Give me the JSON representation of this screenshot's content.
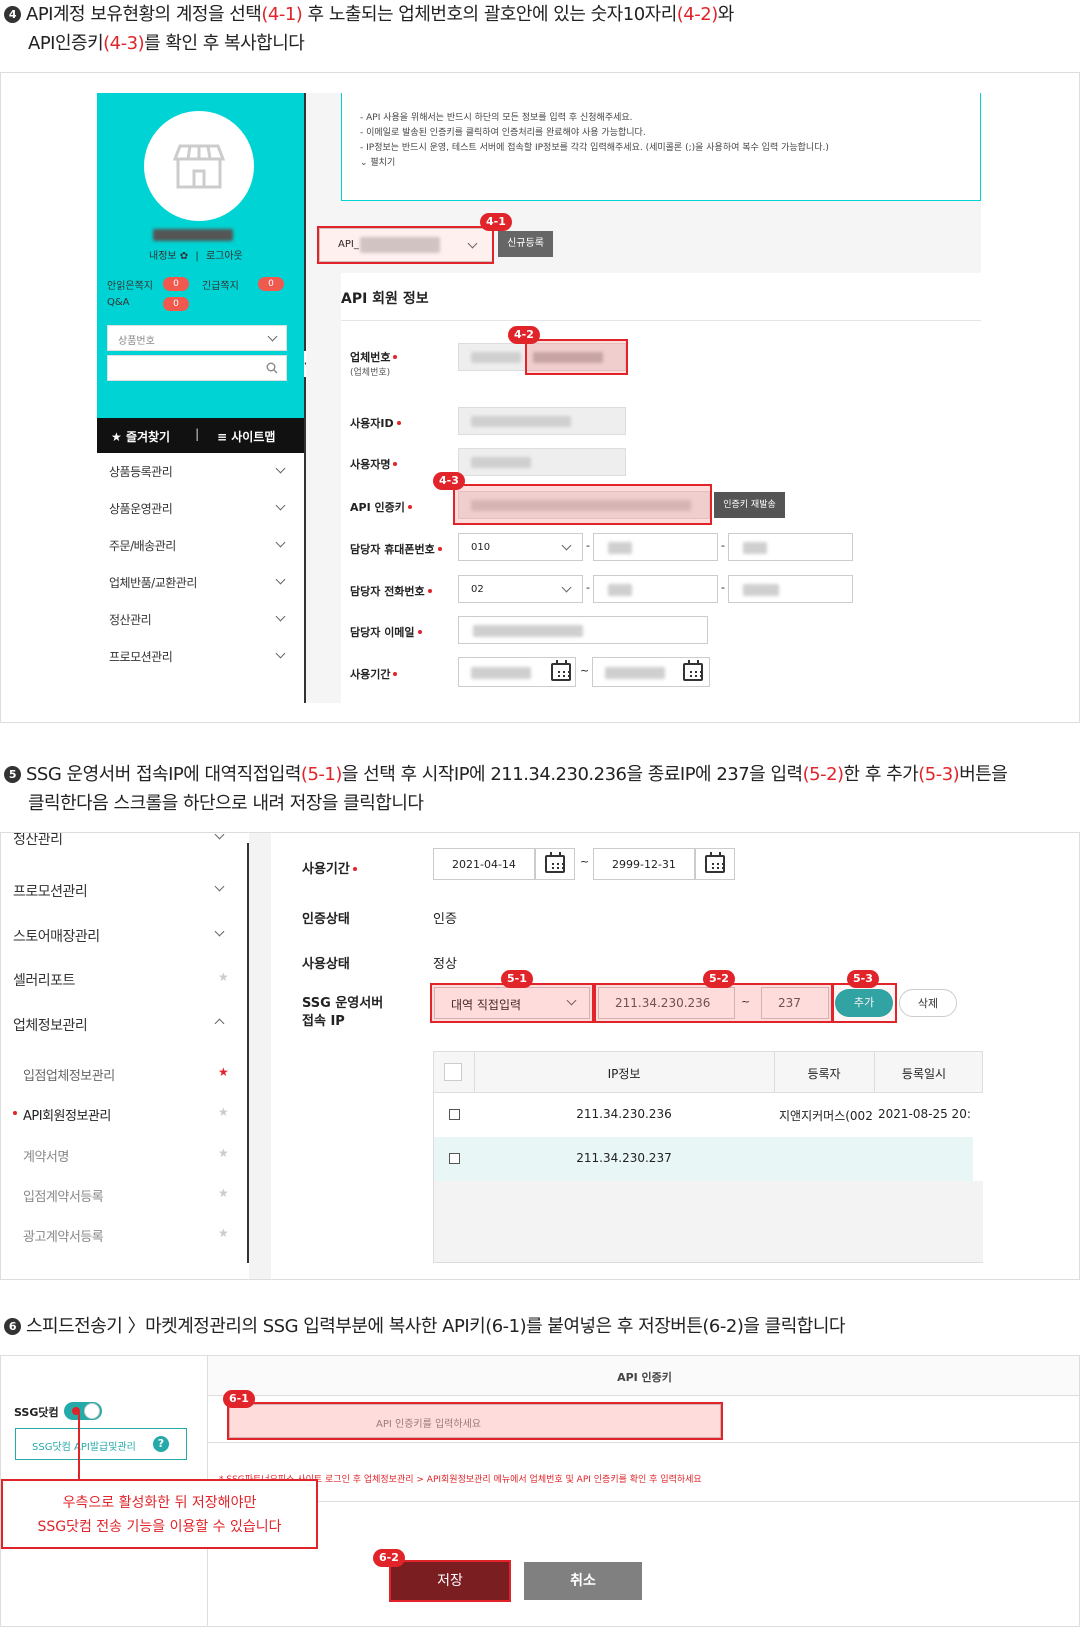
{
  "step4": {
    "num": "4",
    "line1_pre": "API계정 보유현황의 계정을 선택",
    "ref1": "(4-1)",
    "line1_mid": " 후 노출되는 업체번호의 괄호안에 있는 숫자10자리",
    "ref2": "(4-2)",
    "line1_post": "와",
    "line2_pre": "API인증키",
    "ref3": "(4-3)",
    "line2_post": "를 확인 후 복사합니다"
  },
  "shot1": {
    "profile_links": {
      "myinfo": "내정보",
      "logout": "로그아웃"
    },
    "notices": [
      {
        "label": "안읽은쪽지",
        "count": "0"
      },
      {
        "label": "긴급쪽지",
        "count": "0"
      },
      {
        "label": "Q&A",
        "count": "0"
      }
    ],
    "product_select": "상품번호",
    "bar": {
      "favorites": "즐겨찾기",
      "sitemap": "사이트맵"
    },
    "menu": [
      "상품등록관리",
      "상품운영관리",
      "주문/배송관리",
      "업체반품/교환관리",
      "정산관리",
      "프로모션관리"
    ],
    "info_lines": [
      "- API 사용을 위해서는 반드시 하단의 모든 정보를 입력 후 신청해주세요.",
      "- 이메일로 발송된 인증키를 클릭하여 인증처리를 완료해야 사용 가능합니다.",
      "- IP정보는 반드시 운영, 테스트 서버에 접속할 IP정보를 각각 입력해주세요. (세미콜론 (;)을 사용하여 복수 입력 가능합니다.)"
    ],
    "fold": "펼치기",
    "api_select": "API_",
    "new_button": "신규등록",
    "section_title": "API 회원 정보",
    "fields": {
      "company_no": "업체번호",
      "company_no_sub": "(업체번호)",
      "user_id": "사용자ID",
      "user_name": "사용자명",
      "api_key": "API 인증키",
      "reissue": "인증키 재발송",
      "mobile": "담당자 휴대폰번호",
      "mobile_prefix": "010",
      "phone": "담당자 전화번호",
      "phone_prefix": "02",
      "email": "담당자 이메일",
      "period": "사용기간",
      "tilde": "~",
      "dash": "-"
    },
    "tags": {
      "t1": "4-1",
      "t2": "4-2",
      "t3": "4-3"
    }
  },
  "step5": {
    "num": "5",
    "line1_pre": "SSG 운영서버 접속IP에 대역직접입력",
    "ref1": "(5-1)",
    "line1_mid": "을 선택 후 시작IP에 211.34.230.236을 종료IP에 237을 입력",
    "ref2": "(5-2)",
    "line1_mid2": "한 후 추가",
    "ref3": "(5-3)",
    "line1_post": "버튼을",
    "line2": "클릭한다음 스크롤을 하단으로 내려 저장을 클릭합니다"
  },
  "shot2": {
    "menu": [
      {
        "label": "정산관리",
        "icon": "chevron-down"
      },
      {
        "label": "프로모션관리",
        "icon": "chevron-down"
      },
      {
        "label": "스토어매장관리",
        "icon": "chevron-down"
      },
      {
        "label": "셀러리포트",
        "icon": "star"
      },
      {
        "label": "업체정보관리",
        "icon": "chevron-up"
      }
    ],
    "submenu": [
      {
        "label": "입점업체정보관리",
        "star_color": "#e0242a"
      },
      {
        "label": "API회원정보관리",
        "star_color": "#ccc"
      },
      {
        "label": "계약서명",
        "star_color": "#ccc"
      },
      {
        "label": "입점계약서등록",
        "star_color": "#ccc"
      },
      {
        "label": "광고계약서등록",
        "star_color": "#ccc"
      }
    ],
    "period_label": "사용기간",
    "start_date": "2021-04-14",
    "tilde": "~",
    "end_date": "2999-12-31",
    "auth_label": "인증상태",
    "auth_value": "인증",
    "use_label": "사용상태",
    "use_value": "정상",
    "ssg_label_1": "SSG 운영서버",
    "ssg_label_2": "접속 IP",
    "range_select": "대역 직접입력",
    "start_ip": "211.34.230.236",
    "end_ip": "237",
    "add_button": "추가",
    "delete_button": "삭제",
    "tags": {
      "t1": "5-1",
      "t2": "5-2",
      "t3": "5-3"
    },
    "table": {
      "headers": [
        "IP정보",
        "등록자",
        "등록일시"
      ],
      "rows": [
        {
          "ip": "211.34.230.236",
          "user": "지앤지커머스(002",
          "date": "2021-08-25 20:"
        },
        {
          "ip": "211.34.230.237",
          "user": "",
          "date": ""
        }
      ]
    }
  },
  "step6": {
    "num": "6",
    "text": "스피드전송기 〉마켓계정관리의 SSG 입력부분에 복사한 API키(6-1)를 붙여넣은 후 저장버튼(6-2)을 클릭합니다"
  },
  "shot3": {
    "ssg_label": "SSG닷컴",
    "manage_button": "SSG닷컴 API발급및관리",
    "help": "?",
    "header": "API 인증키",
    "placeholder": "API 인증키를 입력하세요",
    "note": "* SSG파트너오피스 사이트 로그인 후 업체정보관리 > API회원정보관리 메뉴에서 업체번호 및 API 인증키를 확인 후 입력하세요",
    "callout_1": "우측으로 활성화한 뒤 저장해야만",
    "callout_2": "SSG닷컴 전송 기능을 이용할 수 있습니다",
    "save": "저장",
    "cancel": "취소",
    "tags": {
      "t1": "6-1",
      "t2": "6-2"
    }
  },
  "colors": {
    "accent_red": "#e0242a",
    "ssg_cyan": "#00d0d0",
    "teal": "#26a9a9",
    "save_dark": "#7b1e22",
    "cancel_gray": "#808080"
  }
}
